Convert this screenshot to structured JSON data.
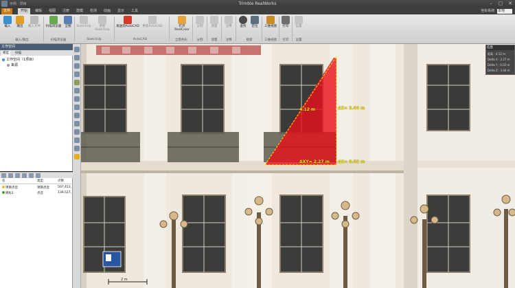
{
  "window": {
    "title": "Trimble RealWorks",
    "quick_access": "示例 · 项目",
    "controls": [
      "–",
      "▢",
      "✕"
    ]
  },
  "ribbon_tabs": [
    "文件",
    "开始",
    "编辑",
    "视图",
    "注册",
    "建模",
    "检测",
    "动画",
    "显示",
    "工具"
  ],
  "ribbon_ctx": {
    "label": "坐标系统",
    "value": "本地"
  },
  "ribbon": {
    "buttons": [
      {
        "label": "载入",
        "group": "载入/输出"
      },
      {
        "label": "输出",
        "group": "载入/输出"
      },
      {
        "label": "载入文件",
        "group": "载入/输出"
      },
      {
        "label": "扫描浏览器",
        "group": "扫描浏览器"
      },
      {
        "label": "全图",
        "group": "扫描浏览器"
      },
      {
        "label": "SketchUp",
        "group": "SketchUp"
      },
      {
        "label": "更新SketchUp",
        "group": "SketchUp"
      },
      {
        "label": "发送到AutoCAD",
        "group": "AutoCAD"
      },
      {
        "label": "更新AutoCAD",
        "group": "AutoCAD"
      },
      {
        "label": "打开RealColor",
        "group": "全景色彩"
      },
      {
        "label": "分割",
        "group": "分割"
      },
      {
        "label": "测量",
        "group": "测量"
      },
      {
        "label": "注释",
        "group": "注释"
      },
      {
        "label": "查找",
        "group": "搜索"
      },
      {
        "label": "定位",
        "group": "搜索"
      },
      {
        "label": "三维视图",
        "group": "三维视图"
      },
      {
        "label": "打印",
        "group": "打印"
      },
      {
        "label": "设置",
        "group": "设置"
      }
    ],
    "groups": [
      "载入/输出",
      "扫描浏览器",
      "SketchUp",
      "AutoCAD",
      "全景色彩",
      "分割",
      "测量",
      "注释",
      "搜索",
      "三维视图",
      "打印",
      "设置"
    ]
  },
  "workspace": {
    "header": "工作空间",
    "tabs": [
      "模型",
      "扫描"
    ],
    "tree": [
      {
        "label": "工作空间（1项目）",
        "indent": 0
      },
      {
        "label": "来源",
        "indent": 1
      }
    ]
  },
  "list": {
    "columns": [
      "名",
      "类型",
      "点数"
    ],
    "rows": [
      {
        "name": "项目点云",
        "type": "项目点云",
        "count": "507,453,"
      },
      {
        "name": "目标1",
        "type": "点云",
        "count": "139,527,"
      }
    ]
  },
  "viewport": {
    "measurements": [
      {
        "label": "4.12 m",
        "color": "#ffee00"
      },
      {
        "label": "ΔZ= 3.44 m",
        "color": "#ffee00"
      },
      {
        "label": "ΔXY= 2.27 m",
        "color": "#ffee00"
      },
      {
        "label": "ΔZ= 0.02 m",
        "color": "#ffee00"
      }
    ],
    "scale_label": "2 m"
  },
  "info_panel": {
    "title": "信息",
    "rows": [
      {
        "k": "距离",
        "v": "4.12 m"
      },
      {
        "k": "Delta X",
        "v": "2.27 m"
      },
      {
        "k": "Delta Y",
        "v": "0.02 m"
      },
      {
        "k": "Delta Z",
        "v": "3.44 m"
      }
    ]
  },
  "colors": {
    "accent": "#c97a16",
    "measure_fill": "#e8101a",
    "measure_line": "#ffee00",
    "panel_header": "#4a5d73"
  }
}
